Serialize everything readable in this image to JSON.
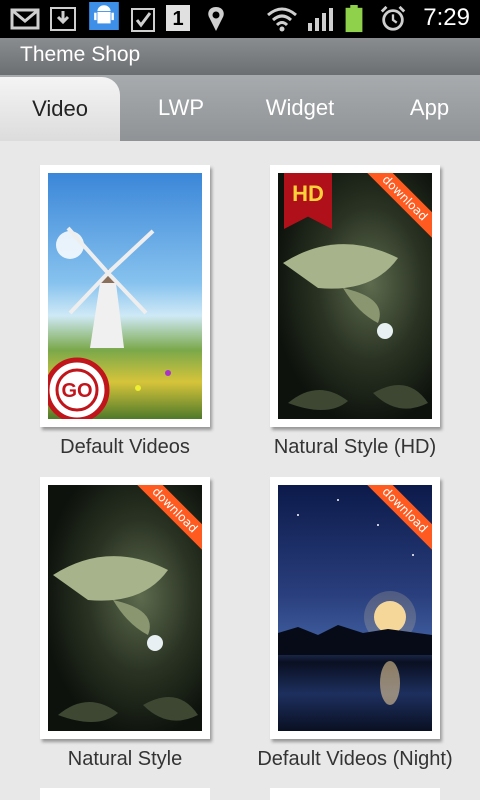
{
  "status_bar": {
    "time": "7:29",
    "icons": [
      "gmail-icon",
      "download-icon",
      "android-icon",
      "task-icon",
      "calendar-icon",
      "location-icon",
      "wifi-icon",
      "signal-icon",
      "battery-icon",
      "alarm-icon"
    ],
    "calendar_day": "1"
  },
  "app": {
    "title": "Theme Shop"
  },
  "tabs": [
    {
      "label": "Video",
      "active": true
    },
    {
      "label": "LWP",
      "active": false
    },
    {
      "label": "Widget",
      "active": false
    },
    {
      "label": "App",
      "active": false
    }
  ],
  "items": [
    {
      "caption": "Default Videos",
      "ribbon": "",
      "badge": "",
      "stamp": "GO"
    },
    {
      "caption": "Natural Style (HD)",
      "ribbon": "download",
      "badge": "HD"
    },
    {
      "caption": "Natural Style",
      "ribbon": "download",
      "badge": ""
    },
    {
      "caption": "Default Videos (Night)",
      "ribbon": "download",
      "badge": ""
    }
  ],
  "colors": {
    "accent": "#ff5a1f",
    "hd_badge": "#b0101a",
    "background": "#e8e8e8"
  }
}
